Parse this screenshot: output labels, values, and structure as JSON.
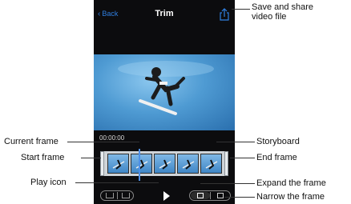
{
  "nav": {
    "back_label": "Back",
    "title": "Trim",
    "share_icon": "share-icon"
  },
  "player": {
    "timecode": "00:00:00"
  },
  "storyboard": {
    "frame_count": 5
  },
  "controls": {
    "play_icon": "play-icon",
    "expand_icon": "expand-frame-icon",
    "narrow_icon": "narrow-frame-icon"
  },
  "callouts": {
    "save_share": "Save and share\nvideo file",
    "current_frame": "Current frame",
    "start_frame": "Start frame",
    "storyboard": "Storyboard",
    "end_frame": "End frame",
    "play_icon": "Play icon",
    "expand_frame": "Expand the frame",
    "narrow_frame": "Narrow the frame"
  },
  "colors": {
    "accent": "#2f7fe0",
    "phone_bg": "#0c0c0e",
    "sky": "#4f9bd3"
  }
}
